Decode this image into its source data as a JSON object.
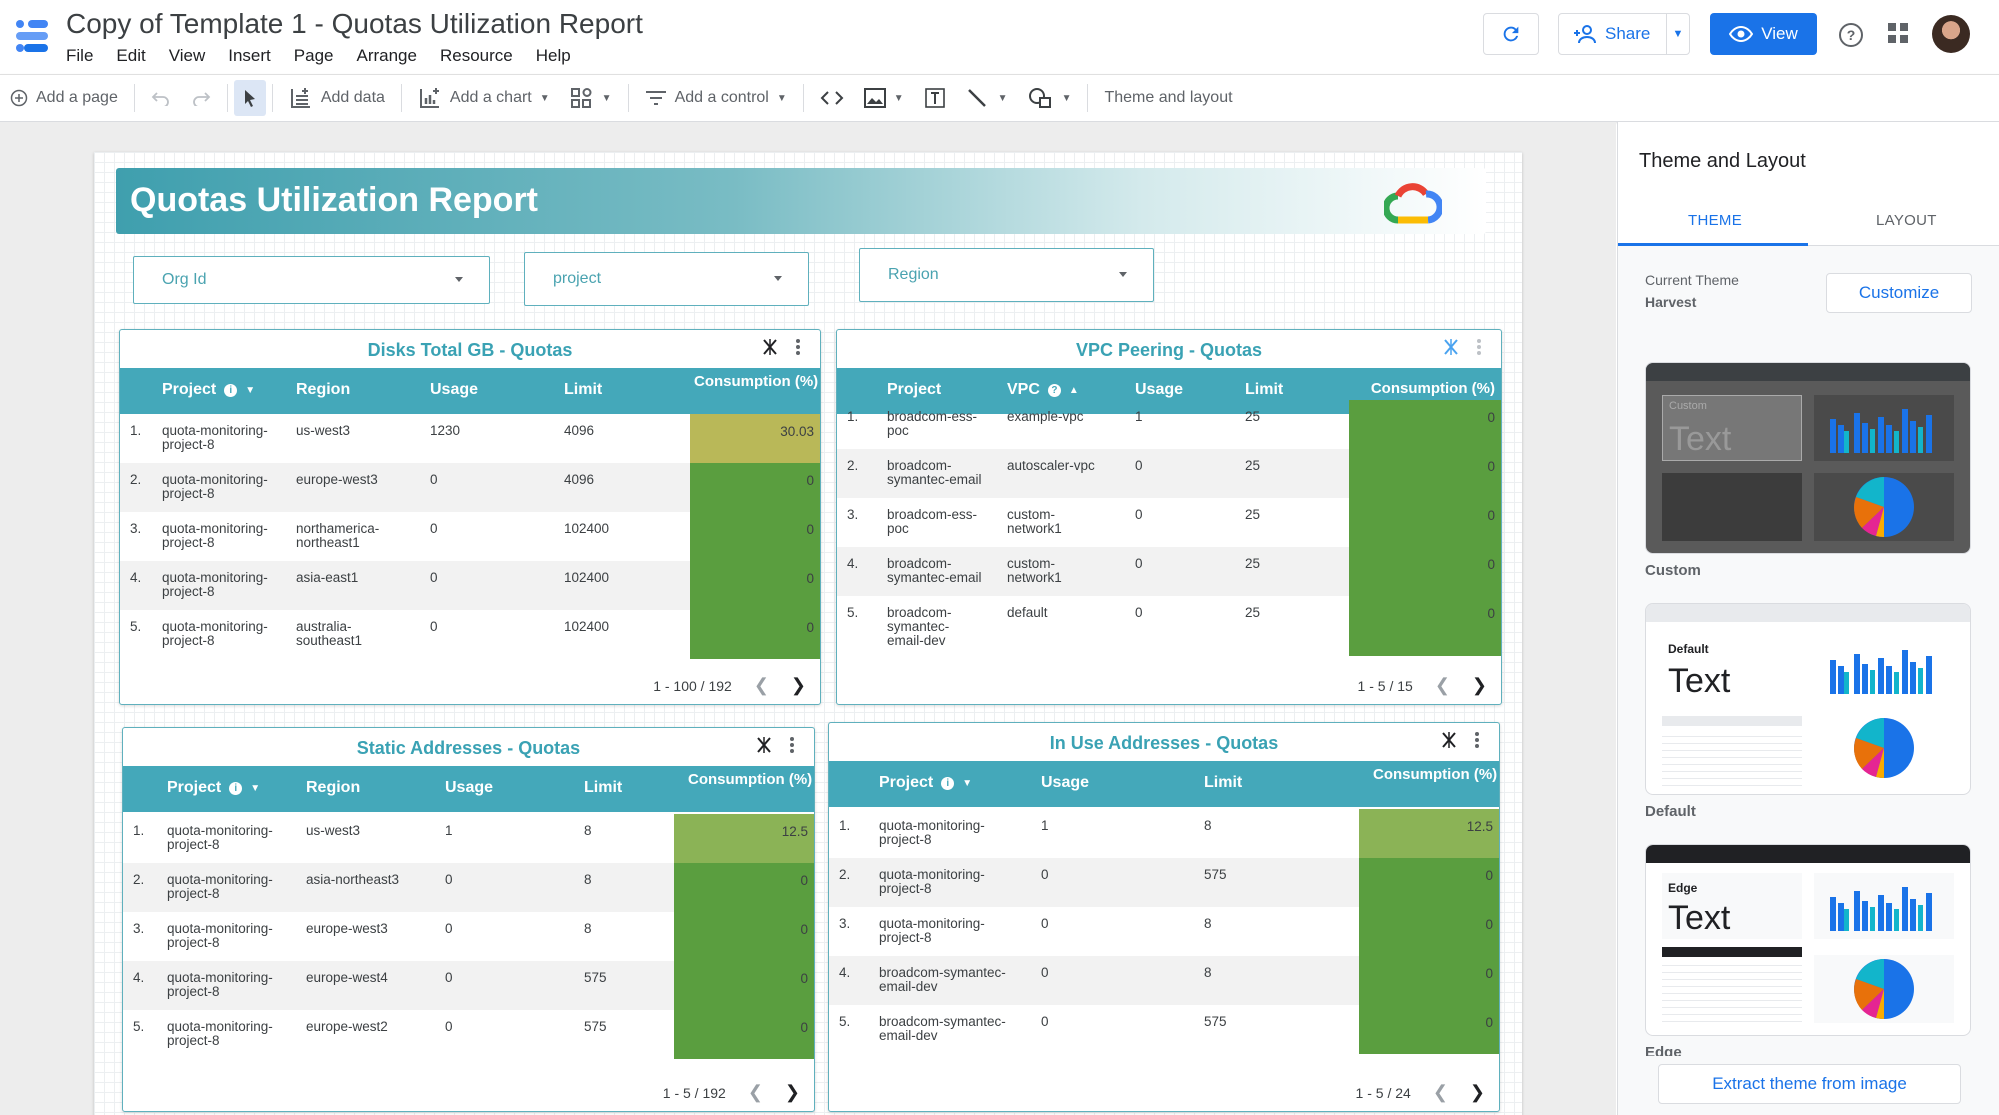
{
  "app": {
    "title": "Copy of Template 1 - Quotas Utilization Report",
    "menu": [
      "File",
      "Edit",
      "View",
      "Insert",
      "Page",
      "Arrange",
      "Resource",
      "Help"
    ],
    "share_label": "Share",
    "view_label": "View"
  },
  "toolbar": {
    "add_page": "Add a page",
    "add_data": "Add data",
    "add_chart": "Add a chart",
    "add_control": "Add a control",
    "theme_layout": "Theme and layout"
  },
  "report": {
    "title": "Quotas Utilization Report",
    "filters": [
      "Org Id",
      "project",
      "Region"
    ]
  },
  "tables": {
    "disks": {
      "title": "Disks Total GB - Quotas",
      "headers": [
        "Project",
        "Region",
        "Usage",
        "Limit",
        "Consumption (%)"
      ],
      "rows": [
        {
          "n": "1.",
          "project": "quota-monitoring-project-8",
          "region": "us-west3",
          "usage": "1230",
          "limit": "4096",
          "cons": "30.03",
          "cons_value": 30.03
        },
        {
          "n": "2.",
          "project": "quota-monitoring-project-8",
          "region": "europe-west3",
          "usage": "0",
          "limit": "4096",
          "cons": "0",
          "cons_value": 0
        },
        {
          "n": "3.",
          "project": "quota-monitoring-project-8",
          "region": "northamerica-northeast1",
          "usage": "0",
          "limit": "102400",
          "cons": "0",
          "cons_value": 0
        },
        {
          "n": "4.",
          "project": "quota-monitoring-project-8",
          "region": "asia-east1",
          "usage": "0",
          "limit": "102400",
          "cons": "0",
          "cons_value": 0
        },
        {
          "n": "5.",
          "project": "quota-monitoring-project-8",
          "region": "australia-southeast1",
          "usage": "0",
          "limit": "102400",
          "cons": "0",
          "cons_value": 0
        }
      ],
      "pager": "1 - 100 / 192"
    },
    "vpc": {
      "title": "VPC Peering - Quotas",
      "headers": [
        "Project",
        "VPC",
        "Usage",
        "Limit",
        "Consumption (%)"
      ],
      "rows": [
        {
          "n": "1.",
          "project": "broadcom-ess-poc",
          "vpc": "example-vpc",
          "usage": "1",
          "limit": "25",
          "cons": "0",
          "cons_value": 0
        },
        {
          "n": "2.",
          "project": "broadcom-symantec-email",
          "vpc": "autoscaler-vpc",
          "usage": "0",
          "limit": "25",
          "cons": "0",
          "cons_value": 0
        },
        {
          "n": "3.",
          "project": "broadcom-ess-poc",
          "vpc": "custom-network1",
          "usage": "0",
          "limit": "25",
          "cons": "0",
          "cons_value": 0
        },
        {
          "n": "4.",
          "project": "broadcom-symantec-email",
          "vpc": "custom-network1",
          "usage": "0",
          "limit": "25",
          "cons": "0",
          "cons_value": 0
        },
        {
          "n": "5.",
          "project": "broadcom-symantec-email-dev",
          "vpc": "default",
          "usage": "0",
          "limit": "25",
          "cons": "0",
          "cons_value": 0
        }
      ],
      "pager": "1 - 5 / 15"
    },
    "static": {
      "title": "Static Addresses - Quotas",
      "headers": [
        "Project",
        "Region",
        "Usage",
        "Limit",
        "Consumption (%)"
      ],
      "rows": [
        {
          "n": "1.",
          "project": "quota-monitoring-project-8",
          "region": "us-west3",
          "usage": "1",
          "limit": "8",
          "cons": "12.5",
          "cons_value": 12.5
        },
        {
          "n": "2.",
          "project": "quota-monitoring-project-8",
          "region": "asia-northeast3",
          "usage": "0",
          "limit": "8",
          "cons": "0",
          "cons_value": 0
        },
        {
          "n": "3.",
          "project": "quota-monitoring-project-8",
          "region": "europe-west3",
          "usage": "0",
          "limit": "8",
          "cons": "0",
          "cons_value": 0
        },
        {
          "n": "4.",
          "project": "quota-monitoring-project-8",
          "region": "europe-west4",
          "usage": "0",
          "limit": "575",
          "cons": "0",
          "cons_value": 0
        },
        {
          "n": "5.",
          "project": "quota-monitoring-project-8",
          "region": "europe-west2",
          "usage": "0",
          "limit": "575",
          "cons": "0",
          "cons_value": 0
        }
      ],
      "pager": "1 - 5 / 192"
    },
    "inuse": {
      "title": "In Use Addresses - Quotas",
      "headers": [
        "Project",
        "Usage",
        "Limit",
        "Consumption (%)"
      ],
      "rows": [
        {
          "n": "1.",
          "project": "quota-monitoring-project-8",
          "usage": "1",
          "limit": "8",
          "cons": "12.5",
          "cons_value": 12.5
        },
        {
          "n": "2.",
          "project": "quota-monitoring-project-8",
          "usage": "0",
          "limit": "575",
          "cons": "0",
          "cons_value": 0
        },
        {
          "n": "3.",
          "project": "quota-monitoring-project-8",
          "usage": "0",
          "limit": "8",
          "cons": "0",
          "cons_value": 0
        },
        {
          "n": "4.",
          "project": "broadcom-symantec-email-dev",
          "usage": "0",
          "limit": "8",
          "cons": "0",
          "cons_value": 0
        },
        {
          "n": "5.",
          "project": "broadcom-symantec-email-dev",
          "usage": "0",
          "limit": "575",
          "cons": "0",
          "cons_value": 0
        }
      ],
      "pager": "1 - 5 / 24"
    }
  },
  "panel": {
    "title": "Theme and Layout",
    "tab_theme": "THEME",
    "tab_layout": "LAYOUT",
    "current_theme_label": "Current Theme",
    "current_theme_name": "Harvest",
    "customize": "Customize",
    "themes": [
      {
        "label": "Custom",
        "preview_text_small": "Custom",
        "preview_text_big": "Text"
      },
      {
        "label": "Default",
        "preview_text_small": "Default",
        "preview_text_big": "Text"
      },
      {
        "label": "Edge",
        "preview_text_small": "Edge",
        "preview_text_big": "Text"
      }
    ],
    "extract": "Extract theme from image"
  },
  "colors": {
    "accent": "#1a73e8",
    "table_header": "#44a8ba",
    "title_teal": "#3aa2b4",
    "cons_zero": "#5a9e3f",
    "cons_12": "#8bb356",
    "cons_30": "#b9b858"
  }
}
